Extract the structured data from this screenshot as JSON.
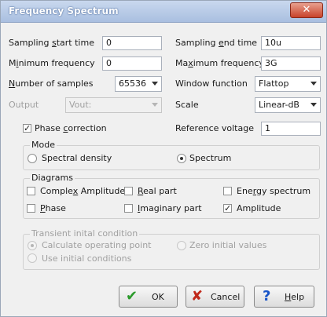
{
  "window": {
    "title": "Frequency Spectrum",
    "close_glyph": "✕"
  },
  "fields": {
    "sampling_start_time": {
      "label_pre": "Sampling ",
      "label_ul": "s",
      "label_post": "tart time",
      "value": "0"
    },
    "sampling_end_time": {
      "label_pre": "Sampling ",
      "label_ul": "e",
      "label_post": "nd time",
      "value": "10u"
    },
    "minimum_frequency": {
      "label_pre": "M",
      "label_ul": "i",
      "label_post": "nimum frequency",
      "value": "0"
    },
    "maximum_frequency": {
      "label_pre": "Ma",
      "label_ul": "x",
      "label_post": "imum frequency",
      "value": "3G"
    },
    "number_of_samples": {
      "label_pre": "",
      "label_ul": "N",
      "label_post": "umber of samples",
      "value": "65536"
    },
    "window_function": {
      "label": "Window function",
      "value": "Flattop"
    },
    "output": {
      "label": "Output",
      "value": "Vout:"
    },
    "scale": {
      "label": "Scale",
      "value": "Linear-dB"
    },
    "phase_correction": {
      "label_pre": "Phase ",
      "label_ul": "c",
      "label_post": "orrection",
      "checked": "✓"
    },
    "reference_voltage": {
      "label": "Reference voltage",
      "value": "1"
    }
  },
  "mode": {
    "title": "Mode",
    "spectral_density": "Spectral density",
    "spectrum": "Spectrum",
    "selected": "spectrum"
  },
  "diagrams": {
    "title": "Diagrams",
    "complex_amplitude": {
      "label_pre": "Comple",
      "label_ul": "x",
      "label_post": " Amplitude"
    },
    "real_part": {
      "label_pre": "",
      "label_ul": "R",
      "label_post": "eal part"
    },
    "energy_spectrum": {
      "label_pre": "Ene",
      "label_ul": "r",
      "label_post": "gy spectrum"
    },
    "phase": {
      "label_pre": "",
      "label_ul": "P",
      "label_post": "hase"
    },
    "imaginary_part": {
      "label_pre": "",
      "label_ul": "I",
      "label_post": "maginary part"
    },
    "amplitude": {
      "label": "Amplitude",
      "checked": "✓"
    }
  },
  "transient": {
    "title": "Transient inital condition",
    "calculate_operating_point": "Calculate operating point",
    "zero_initial_values": "Zero initial values",
    "use_initial_conditions": "Use initial conditions"
  },
  "buttons": {
    "ok": {
      "label": "OK",
      "icon": "✔"
    },
    "cancel": {
      "label": "Cancel",
      "icon": "✘"
    },
    "help": {
      "label_pre": "",
      "label_ul": "H",
      "label_post": "elp",
      "icon": "?"
    }
  },
  "colors": {
    "title_bar": "#b8cce8",
    "close_button": "#c8432b",
    "ok_icon": "#2a9a2a",
    "cancel_icon": "#c0281a",
    "help_icon": "#1a56c8"
  }
}
